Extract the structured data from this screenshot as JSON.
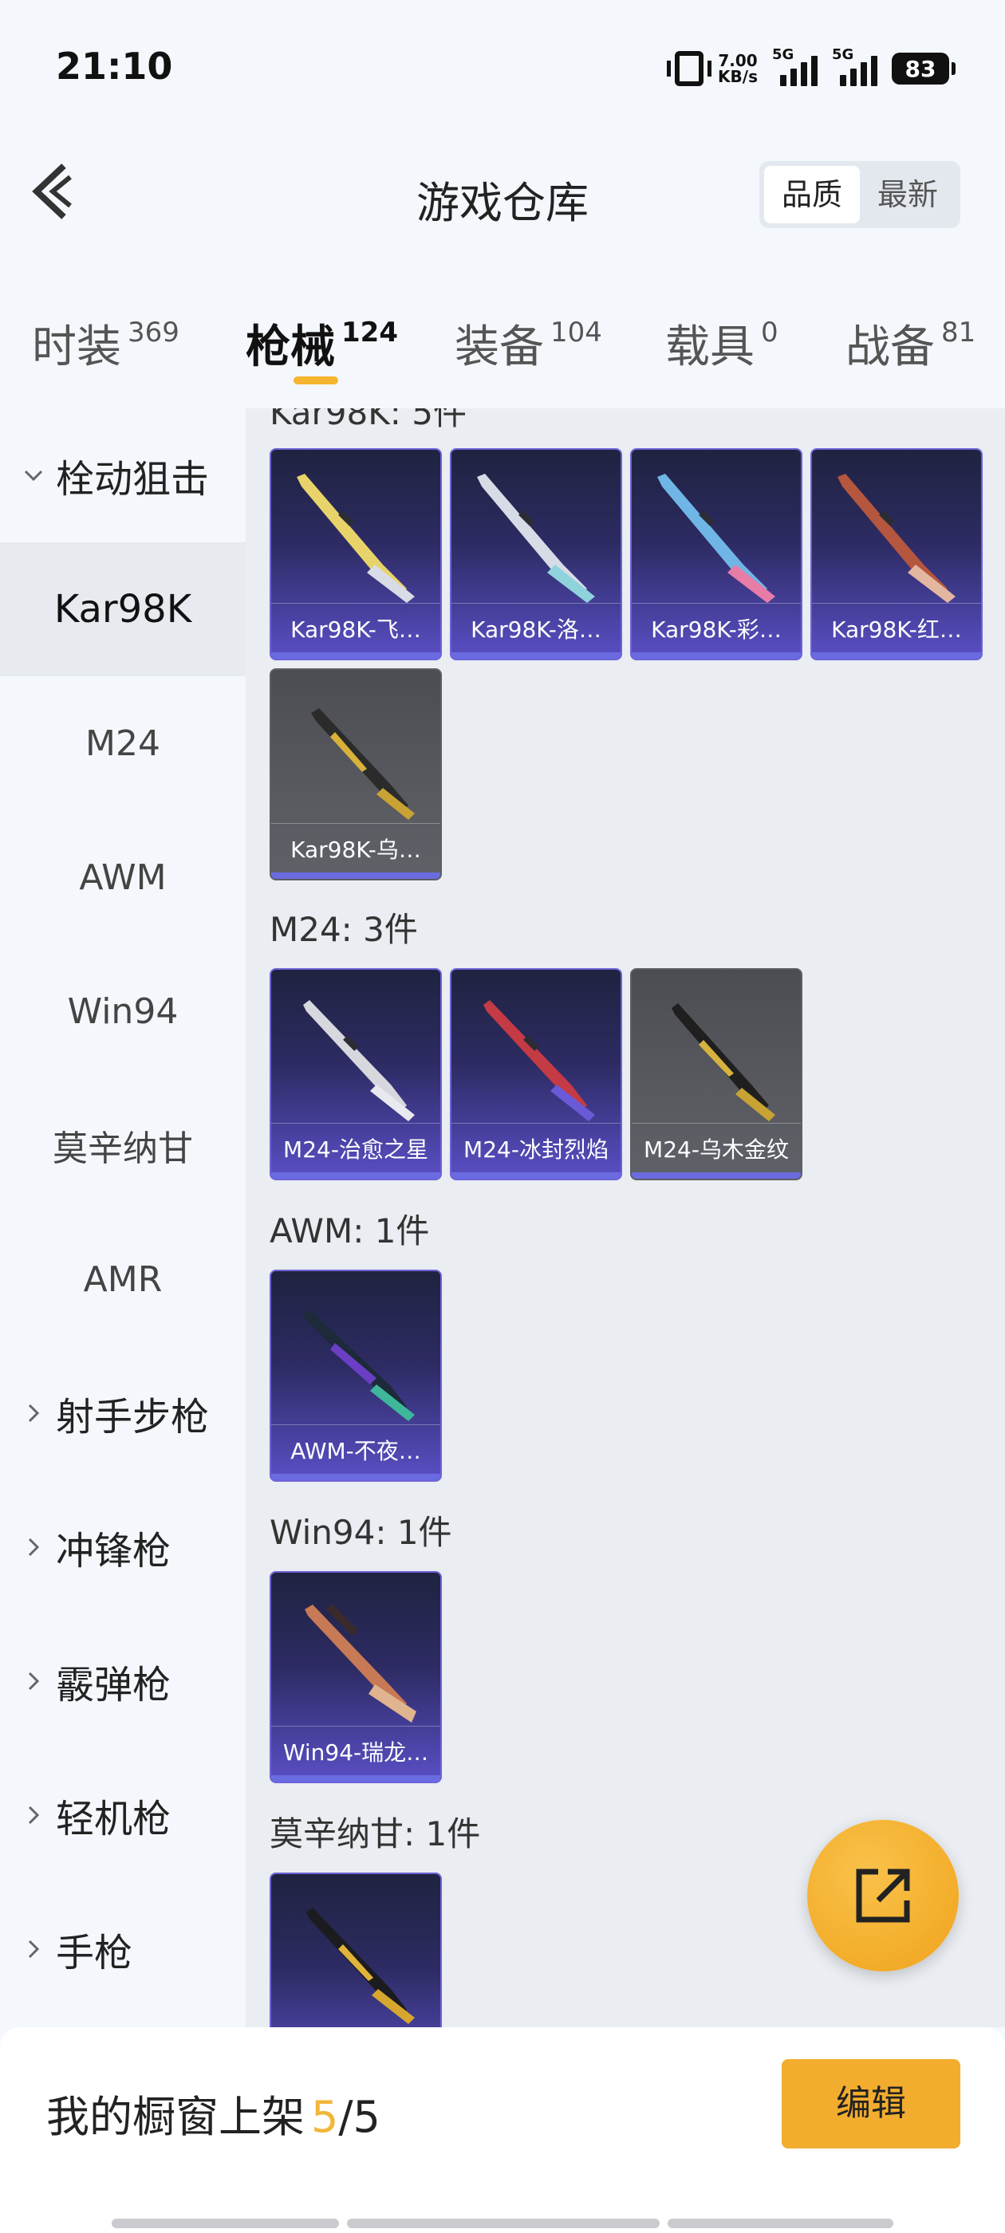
{
  "status_bar": {
    "time": "21:10",
    "net_speed": "7.00",
    "net_unit": "KB/s",
    "sim1": "5G",
    "sim2": "5G",
    "battery": "83"
  },
  "header": {
    "title": "游戏仓库",
    "sort_options": [
      "品质",
      "最新"
    ],
    "sort_selected": "品质"
  },
  "tabs": [
    {
      "label": "时装",
      "count": "369"
    },
    {
      "label": "枪械",
      "count": "124"
    },
    {
      "label": "装备",
      "count": "104"
    },
    {
      "label": "载具",
      "count": "0"
    },
    {
      "label": "战备",
      "count": "81"
    }
  ],
  "active_tab": "枪械",
  "sidebar": {
    "items": [
      {
        "label": "栓动狙击",
        "kind": "group-open"
      },
      {
        "label": "Kar98K",
        "kind": "sub",
        "active": true
      },
      {
        "label": "M24",
        "kind": "sub"
      },
      {
        "label": "AWM",
        "kind": "sub"
      },
      {
        "label": "Win94",
        "kind": "sub"
      },
      {
        "label": "莫辛纳甘",
        "kind": "sub"
      },
      {
        "label": "AMR",
        "kind": "sub"
      },
      {
        "label": "射手步枪",
        "kind": "group"
      },
      {
        "label": "冲锋枪",
        "kind": "group"
      },
      {
        "label": "霰弹枪",
        "kind": "group"
      },
      {
        "label": "轻机枪",
        "kind": "group"
      },
      {
        "label": "手枪",
        "kind": "group"
      }
    ]
  },
  "content": {
    "groups": [
      {
        "title": "Kar98K: 5件",
        "items": [
          "Kar98K-飞…",
          "Kar98K-洛…",
          "Kar98K-彩…",
          "Kar98K-红…",
          "Kar98K-乌…"
        ]
      },
      {
        "title": "M24: 3件",
        "items": [
          "M24-治愈之星",
          "M24-冰封烈焰",
          "M24-乌木金纹"
        ]
      },
      {
        "title": "AWM: 1件",
        "items": [
          "AWM-不夜…"
        ]
      },
      {
        "title": "Win94: 1件",
        "items": [
          "Win94-瑞龙…"
        ]
      },
      {
        "title": "莫辛纳甘: 1件",
        "items": [
          ""
        ]
      }
    ]
  },
  "bottom": {
    "shelf_prefix": "我的橱窗上架",
    "shelf_count": "5",
    "shelf_total": "/5",
    "edit_label": "编辑"
  },
  "icons": {
    "back": "back-arrow-icon",
    "share": "share-external-icon",
    "expand": "chevron-down-icon",
    "collapse": "chevron-right-icon"
  },
  "colors": {
    "accent": "#f2ad2f",
    "card_purple": "#5a4fc6",
    "card_grey": "#585a60"
  }
}
